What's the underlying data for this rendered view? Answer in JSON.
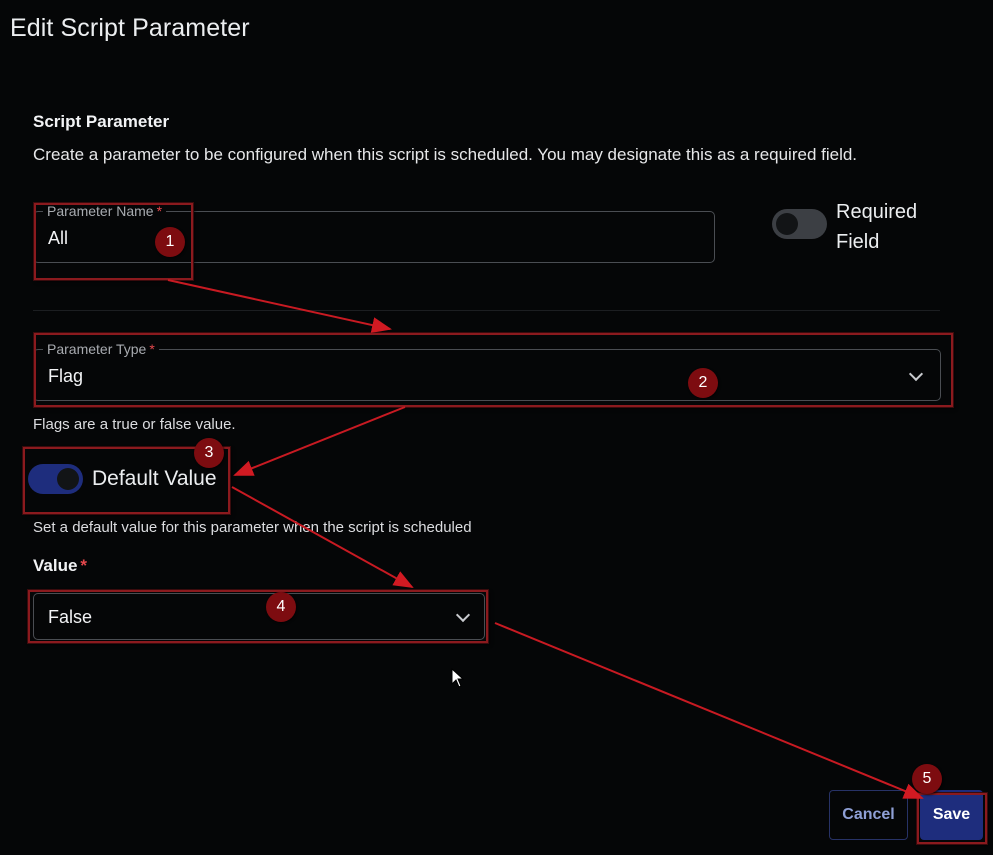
{
  "dialog": {
    "title": "Edit Script Parameter"
  },
  "section": {
    "heading": "Script Parameter",
    "description": "Create a parameter to be configured when this script is scheduled. You may designate this as a required field."
  },
  "parameter_name": {
    "label": "Parameter Name",
    "required_mark": "*",
    "value": "All"
  },
  "required_field": {
    "label_line1": "Required",
    "label_line2": "Field",
    "checked": false
  },
  "parameter_type": {
    "label": "Parameter Type",
    "required_mark": "*",
    "value": "Flag",
    "helper": "Flags are a true or false value."
  },
  "default_value": {
    "label": "Default Value",
    "checked": true,
    "helper": "Set a default value for this parameter when the script is scheduled"
  },
  "value_field": {
    "label": "Value",
    "required_mark": "*",
    "value": "False"
  },
  "buttons": {
    "cancel": "Cancel",
    "save": "Save"
  },
  "annotations": [
    "1",
    "2",
    "3",
    "4",
    "5"
  ],
  "colors": {
    "background": "#050607",
    "accent": "#1e2d7d",
    "annotation": "#8b1a1e",
    "required": "#e5484d"
  }
}
